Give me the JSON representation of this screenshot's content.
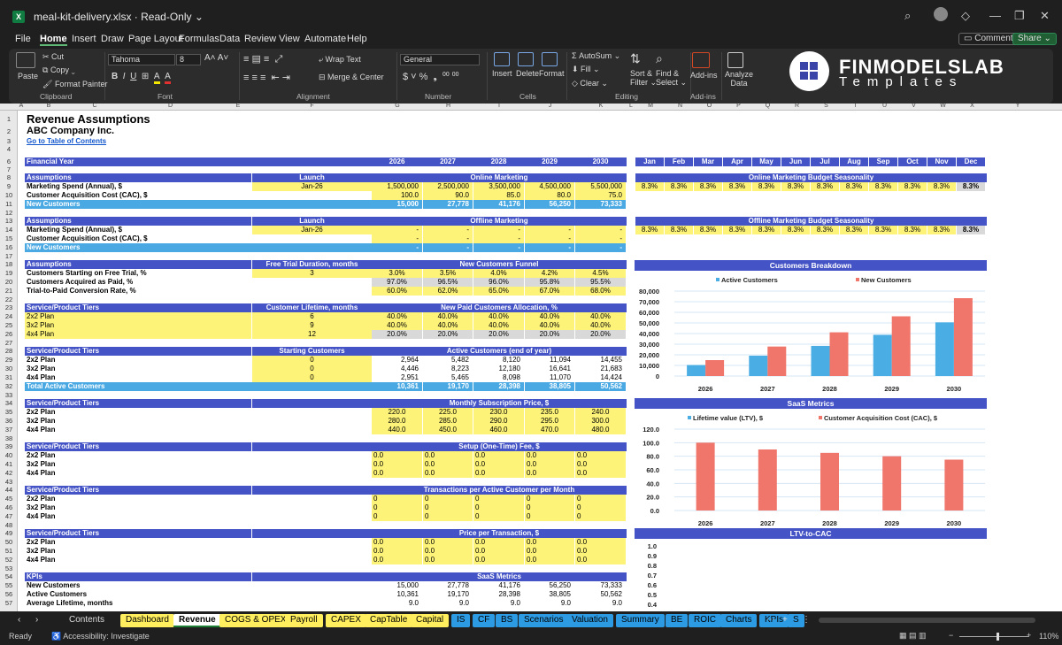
{
  "window": {
    "filename": "meal-kit-delivery.xlsx",
    "mode": "Read-Only ⌄"
  },
  "menu": [
    "File",
    "Home",
    "Insert",
    "Draw",
    "Page Layout",
    "Formulas",
    "Data",
    "Review",
    "View",
    "Automate",
    "Help"
  ],
  "top_buttons": {
    "comments": "Comments",
    "share": "Share ⌄"
  },
  "ribbon": {
    "paste": "Paste",
    "cut": "Cut",
    "copy": "Copy ⌄",
    "format_painter": "Format Painter",
    "clipboard": "Clipboard",
    "font_name": "Tahoma",
    "font_size": "8",
    "font": "Font",
    "alignment": "Alignment",
    "wrap": "Wrap Text",
    "merge": "Merge & Center",
    "number_format": "General",
    "number": "Number",
    "insert": "Insert",
    "delete": "Delete",
    "format": "Format",
    "cells": "Cells",
    "autosum": "AutoSum ⌄",
    "fill": "Fill ⌄",
    "clear": "Clear ⌄",
    "sort": "Sort &\nFilter ⌄",
    "find": "Find &\nSelect ⌄",
    "editing": "Editing",
    "addins": "Add-ins",
    "addins_group": "Add-ins",
    "analyze": "Analyze\nData"
  },
  "logo": {
    "line1": "FINMODELSLAB",
    "line2": "Templates"
  },
  "columns": [
    "A",
    "B",
    "C",
    "D",
    "E",
    "F",
    "G",
    "H",
    "I",
    "J",
    "K",
    "L",
    "M",
    "N",
    "O",
    "P",
    "Q",
    "R",
    "S",
    "T",
    "U",
    "V",
    "W",
    "X",
    "Y"
  ],
  "sheet": {
    "title": "Revenue Assumptions",
    "company": "ABC Company Inc.",
    "toc": "Go to Table of Contents",
    "financial_year": "Financial Year",
    "years": [
      "2026",
      "2027",
      "2028",
      "2029",
      "2030"
    ],
    "months": [
      "Jan",
      "Feb",
      "Mar",
      "Apr",
      "May",
      "Jun",
      "Jul",
      "Aug",
      "Sep",
      "Oct",
      "Nov",
      "Dec"
    ],
    "online": {
      "hdr": "Assumptions",
      "launch": "Launch",
      "title": "Online Marketing",
      "r1": "Marketing Spend (Annual), $",
      "r1_launch": "Jan-26",
      "r1_vals": [
        "1,500,000",
        "2,500,000",
        "3,500,000",
        "4,500,000",
        "5,500,000"
      ],
      "r2": "Customer Acquisition Cost (CAC), $",
      "r2_vals": [
        "100.0",
        "90.0",
        "85.0",
        "80.0",
        "75.0"
      ],
      "r3": "New Customers",
      "r3_vals": [
        "15,000",
        "27,778",
        "41,176",
        "56,250",
        "73,333"
      ],
      "season_title": "Online Marketing Budget Seasonality",
      "season": [
        "8.3%",
        "8.3%",
        "8.3%",
        "8.3%",
        "8.3%",
        "8.3%",
        "8.3%",
        "8.3%",
        "8.3%",
        "8.3%",
        "8.3%",
        "8.3%"
      ]
    },
    "offline": {
      "hdr": "Assumptions",
      "launch": "Launch",
      "title": "Offline Marketing",
      "r1": "Marketing Spend (Annual), $",
      "r1_launch": "Jan-26",
      "r1_vals": [
        "-",
        "-",
        "-",
        "-",
        "-"
      ],
      "r2": "Customer Acquisition Cost (CAC), $",
      "r2_vals": [
        "-",
        "-",
        "-",
        "-",
        "-"
      ],
      "r3": "New Customers",
      "r3_vals": [
        "-",
        "-",
        "-",
        "-",
        "-"
      ],
      "season_title": "Offline Marketing Budget Seasonality",
      "season": [
        "8.3%",
        "8.3%",
        "8.3%",
        "8.3%",
        "8.3%",
        "8.3%",
        "8.3%",
        "8.3%",
        "8.3%",
        "8.3%",
        "8.3%",
        "8.3%"
      ]
    },
    "funnel": {
      "hdr": "Assumptions",
      "mid": "Free Trial Duration, months",
      "title": "New Customers Funnel",
      "r1": "Customers Starting on Free Trial, %",
      "r1_mid": "3",
      "r1_vals": [
        "3.0%",
        "3.5%",
        "4.0%",
        "4.2%",
        "4.5%"
      ],
      "r2": "Customers Acquired as Paid, %",
      "r2_vals": [
        "97.0%",
        "96.5%",
        "96.0%",
        "95.8%",
        "95.5%"
      ],
      "r3": "Trial-to-Paid Conversion Rate, %",
      "r3_vals": [
        "60.0%",
        "62.0%",
        "65.0%",
        "67.0%",
        "68.0%"
      ]
    },
    "alloc": {
      "hdr": "Service/Product Tiers",
      "mid": "Customer Lifetime, months",
      "title": "New Paid Customers Allocation, %",
      "rows": [
        {
          "n": "2x2 Plan",
          "m": "6",
          "v": [
            "40.0%",
            "40.0%",
            "40.0%",
            "40.0%",
            "40.0%"
          ]
        },
        {
          "n": "3x2 Plan",
          "m": "9",
          "v": [
            "40.0%",
            "40.0%",
            "40.0%",
            "40.0%",
            "40.0%"
          ]
        },
        {
          "n": "4x4 Plan",
          "m": "12",
          "v": [
            "20.0%",
            "20.0%",
            "20.0%",
            "20.0%",
            "20.0%"
          ]
        }
      ]
    },
    "active": {
      "hdr": "Service/Product Tiers",
      "mid": "Starting Customers",
      "title": "Active Customers (end of year)",
      "rows": [
        {
          "n": "2x2 Plan",
          "m": "0",
          "v": [
            "2,964",
            "5,482",
            "8,120",
            "11,094",
            "14,455"
          ]
        },
        {
          "n": "3x2 Plan",
          "m": "0",
          "v": [
            "4,446",
            "8,223",
            "12,180",
            "16,641",
            "21,683"
          ]
        },
        {
          "n": "4x4 Plan",
          "m": "0",
          "v": [
            "2,951",
            "5,465",
            "8,098",
            "11,070",
            "14,424"
          ]
        }
      ],
      "total": "Total Active Customers",
      "total_vals": [
        "10,361",
        "19,170",
        "28,398",
        "38,805",
        "50,562"
      ]
    },
    "price": {
      "hdr": "Service/Product Tiers",
      "title": "Monthly Subscription Price, $",
      "rows": [
        {
          "n": "2x2 Plan",
          "v": [
            "220.0",
            "225.0",
            "230.0",
            "235.0",
            "240.0"
          ]
        },
        {
          "n": "3x2 Plan",
          "v": [
            "280.0",
            "285.0",
            "290.0",
            "295.0",
            "300.0"
          ]
        },
        {
          "n": "4x4 Plan",
          "v": [
            "440.0",
            "450.0",
            "460.0",
            "470.0",
            "480.0"
          ]
        }
      ]
    },
    "setup": {
      "hdr": "Service/Product Tiers",
      "title": "Setup (One-Time) Fee, $",
      "rows": [
        {
          "n": "2x2 Plan",
          "v": [
            "0.0",
            "0.0",
            "0.0",
            "0.0",
            "0.0"
          ]
        },
        {
          "n": "3x2 Plan",
          "v": [
            "0.0",
            "0.0",
            "0.0",
            "0.0",
            "0.0"
          ]
        },
        {
          "n": "4x4 Plan",
          "v": [
            "0.0",
            "0.0",
            "0.0",
            "0.0",
            "0.0"
          ]
        }
      ]
    },
    "trans": {
      "hdr": "Service/Product Tiers",
      "title": "Transactions per Active Customer per Month",
      "rows": [
        {
          "n": "2x2 Plan",
          "v": [
            "0",
            "0",
            "0",
            "0",
            "0"
          ]
        },
        {
          "n": "3x2 Plan",
          "v": [
            "0",
            "0",
            "0",
            "0",
            "0"
          ]
        },
        {
          "n": "4x4 Plan",
          "v": [
            "0",
            "0",
            "0",
            "0",
            "0"
          ]
        }
      ]
    },
    "ppt": {
      "hdr": "Service/Product Tiers",
      "title": "Price per Transaction, $",
      "rows": [
        {
          "n": "2x2 Plan",
          "v": [
            "0.0",
            "0.0",
            "0.0",
            "0.0",
            "0.0"
          ]
        },
        {
          "n": "3x2 Plan",
          "v": [
            "0.0",
            "0.0",
            "0.0",
            "0.0",
            "0.0"
          ]
        },
        {
          "n": "4x4 Plan",
          "v": [
            "0.0",
            "0.0",
            "0.0",
            "0.0",
            "0.0"
          ]
        }
      ]
    },
    "kpis": {
      "hdr": "KPIs",
      "title": "SaaS Metrics",
      "rows": [
        {
          "n": "New Customers",
          "v": [
            "15,000",
            "27,778",
            "41,176",
            "56,250",
            "73,333"
          ]
        },
        {
          "n": "Active Customers",
          "v": [
            "10,361",
            "19,170",
            "28,398",
            "38,805",
            "50,562"
          ]
        },
        {
          "n": "Average Lifetime, months",
          "v": [
            "9.0",
            "9.0",
            "9.0",
            "9.0",
            "9.0"
          ]
        }
      ]
    }
  },
  "charts": {
    "breakdown_title": "Customers Breakdown",
    "saas_title": "SaaS Metrics",
    "ltv_title": "LTV-to-CAC"
  },
  "chart_data": [
    {
      "type": "bar",
      "title": "Customers Breakdown",
      "categories": [
        "2026",
        "2027",
        "2028",
        "2029",
        "2030"
      ],
      "series": [
        {
          "name": "Active Customers",
          "values": [
            10361,
            19170,
            28398,
            38805,
            50562
          ],
          "color": "#4aaee4"
        },
        {
          "name": "New Customers",
          "values": [
            15000,
            27778,
            41176,
            56250,
            73333
          ],
          "color": "#f0766b"
        }
      ],
      "ylim": [
        0,
        80000
      ],
      "yticks": [
        "80,000",
        "70,000",
        "60,000",
        "50,000",
        "40,000",
        "30,000",
        "20,000",
        "10,000",
        "0"
      ],
      "legend": "top"
    },
    {
      "type": "bar",
      "title": "SaaS Metrics",
      "categories": [
        "2026",
        "2027",
        "2028",
        "2029",
        "2030"
      ],
      "series": [
        {
          "name": "Lifetime value (LTV), $",
          "values": [
            0,
            0,
            0,
            0,
            0
          ],
          "color": "#4aaee4"
        },
        {
          "name": "Customer Acquisition Cost (CAC), $",
          "values": [
            100,
            90,
            85,
            80,
            75
          ],
          "color": "#f0766b"
        }
      ],
      "ylim": [
        0,
        120
      ],
      "yticks": [
        "120.0",
        "100.0",
        "80.0",
        "60.0",
        "40.0",
        "20.0",
        "0.0"
      ],
      "legend": "top"
    },
    {
      "type": "line",
      "title": "LTV-to-CAC",
      "yticks": [
        "1.0",
        "0.9",
        "0.8",
        "0.7",
        "0.6",
        "0.5",
        "0.4"
      ],
      "ylim": [
        0.4,
        1.0
      ]
    }
  ],
  "tabs": [
    {
      "label": "Contents",
      "style": "plain"
    },
    {
      "label": "Dashboard",
      "style": "y"
    },
    {
      "label": "Revenue",
      "style": "act"
    },
    {
      "label": "COGS & OPEX",
      "style": "y"
    },
    {
      "label": "Payroll",
      "style": "y"
    },
    {
      "label": "CAPEX",
      "style": "y"
    },
    {
      "label": "CapTable",
      "style": "y"
    },
    {
      "label": "Capital",
      "style": "y"
    },
    {
      "label": "IS",
      "style": "bl"
    },
    {
      "label": "CF",
      "style": "bl"
    },
    {
      "label": "BS",
      "style": "bl"
    },
    {
      "label": "Scenarios",
      "style": "bl"
    },
    {
      "label": "Valuation",
      "style": "bl"
    },
    {
      "label": "Summary",
      "style": "bl"
    },
    {
      "label": "BE",
      "style": "bl"
    },
    {
      "label": "ROIC",
      "style": "bl"
    },
    {
      "label": "Charts",
      "style": "bl"
    },
    {
      "label": "KPIs",
      "style": "bl"
    },
    {
      "label": "S",
      "style": "bl"
    }
  ],
  "status": {
    "ready": "Ready",
    "accessibility": "Accessibility: Investigate",
    "zoom": "110%"
  }
}
